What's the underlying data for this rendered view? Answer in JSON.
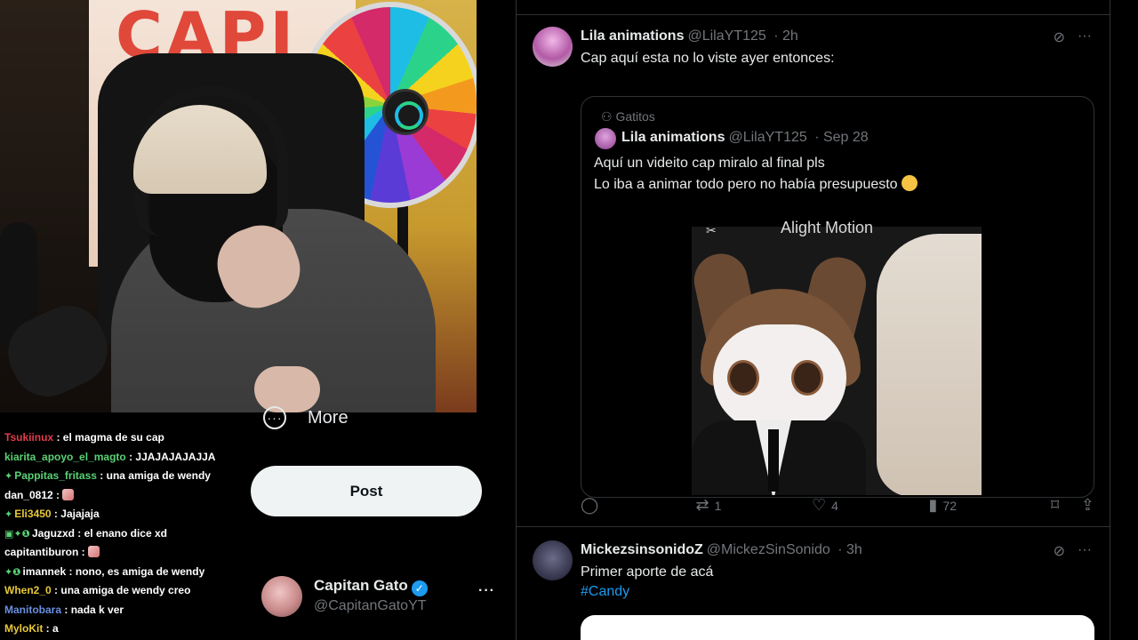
{
  "chat": [
    {
      "user": "Tsukiinux",
      "color": "#e23c4a",
      "badges": "",
      "message": "el magma de su cap",
      "emote": false
    },
    {
      "user": "kiarita_apoyo_el_magto",
      "color": "#5ad174",
      "badges": "",
      "message": "JJAJAJAJAJJA",
      "emote": false
    },
    {
      "user": "Pappitas_fritass",
      "color": "#5ad174",
      "badges": "✦",
      "message": "una amiga de wendy",
      "emote": false
    },
    {
      "user": "dan_0812",
      "color": "#ffffff",
      "badges": "",
      "message": "",
      "emote": true
    },
    {
      "user": "Eli3450",
      "color": "#e7c83a",
      "badges": "✦",
      "message": "Jajajaja",
      "emote": false
    },
    {
      "user": "Jaguzxd",
      "color": "#ffffff",
      "badges": "▣✦❶",
      "message": "el enano dice xd",
      "emote": false
    },
    {
      "user": "capitantiburon",
      "color": "#ffffff",
      "badges": "",
      "message": "",
      "emote": true
    },
    {
      "user": "imannek",
      "color": "#ffffff",
      "badges": "✦❶",
      "message": "nono, es amiga de wendy",
      "emote": false
    },
    {
      "user": "When2_0",
      "color": "#e7c83a",
      "badges": "",
      "message": "una amiga de wendy creo",
      "emote": false
    },
    {
      "user": "Manitobara",
      "color": "#6a8fe0",
      "badges": "",
      "message": "nada k ver",
      "emote": false
    },
    {
      "user": "MyloKit",
      "color": "#e7c83a",
      "badges": "",
      "message": "a",
      "emote": false
    }
  ],
  "sidebar": {
    "more_label": "More",
    "post_label": "Post",
    "account_name": "Capitan Gato",
    "account_handle": "@CapitanGatoYT",
    "more_dots": "···",
    "verified_mark": "✓"
  },
  "webcam": {
    "poster_text": "CAPI"
  },
  "tweets": [
    {
      "name": "Lila animations",
      "handle": "@LilaYT125",
      "time": "2h",
      "text": "Cap aquí esta no lo viste ayer entonces:",
      "quote": {
        "community": "Gatitos",
        "name": "Lila animations",
        "handle": "@LilaYT125",
        "time": "Sep 28",
        "line1": "Aquí un videito cap miralo al final pls",
        "line2": "Lo iba a animar todo pero no había presupuesto",
        "watermark": "Alight Motion"
      },
      "replies": "",
      "retweets": "1",
      "likes": "4",
      "views": "72"
    },
    {
      "name": "MickezsinsonidoZ",
      "handle": "@MickezSinSonido",
      "time": "3h",
      "text": "Primer aporte de acá",
      "hashtag": "#Candy"
    }
  ],
  "icons": {
    "grok": "⊘",
    "more": "···",
    "reply": "◯",
    "retweet": "⇄",
    "like": "♡",
    "views": "▮",
    "bookmark": "⌑",
    "share": "⇪",
    "community": "⚇"
  }
}
